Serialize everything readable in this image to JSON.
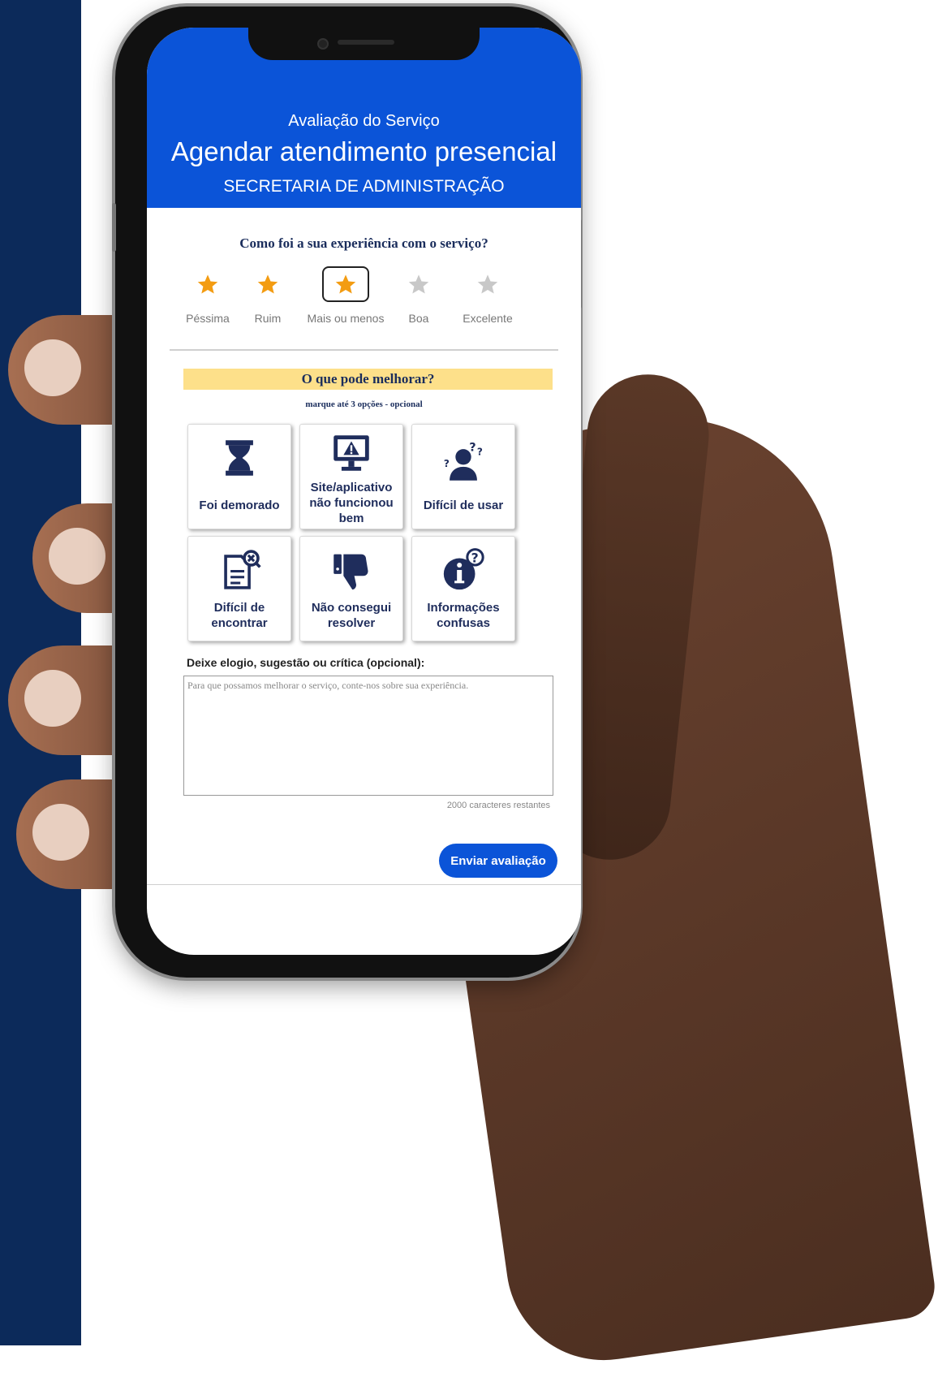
{
  "colors": {
    "header_bg": "#0b54d8",
    "side_band": "#0c2a5a",
    "star_active": "#f39c12",
    "star_inactive": "#c8c8c8",
    "improve_bar": "#fde08a",
    "icon_navy": "#1f2d5c"
  },
  "header": {
    "subtitle": "Avaliação do Serviço",
    "title": "Agendar atendimento presencial",
    "department": "SECRETARIA DE ADMINISTRAÇÃO"
  },
  "rating": {
    "question": "Como foi a sua experiência com o serviço?",
    "selected_value": 3,
    "options": [
      {
        "label": "Péssima",
        "active": true
      },
      {
        "label": "Ruim",
        "active": true
      },
      {
        "label": "Mais ou menos",
        "active": true
      },
      {
        "label": "Boa",
        "active": false
      },
      {
        "label": "Excelente",
        "active": false
      }
    ]
  },
  "improve": {
    "title": "O que pode melhorar?",
    "hint": "marque até 3 opções - opcional",
    "options": [
      {
        "label": "Foi demorado",
        "icon": "hourglass-icon"
      },
      {
        "label": "Site/aplicativo não funcionou bem",
        "icon": "monitor-warning-icon"
      },
      {
        "label": "Difícil de usar",
        "icon": "user-question-icon"
      },
      {
        "label": "Difícil de encontrar",
        "icon": "document-search-icon"
      },
      {
        "label": "Não consegui resolver",
        "icon": "thumbs-down-icon"
      },
      {
        "label": "Informações confusas",
        "icon": "info-question-icon"
      }
    ]
  },
  "comment": {
    "label": "Deixe elogio, sugestão ou crítica (opcional):",
    "placeholder": "Para que possamos melhorar o serviço, conte-nos sobre sua experiência.",
    "chars_remaining": "2000 caracteres restantes"
  },
  "submit_label": "Enviar avaliação"
}
